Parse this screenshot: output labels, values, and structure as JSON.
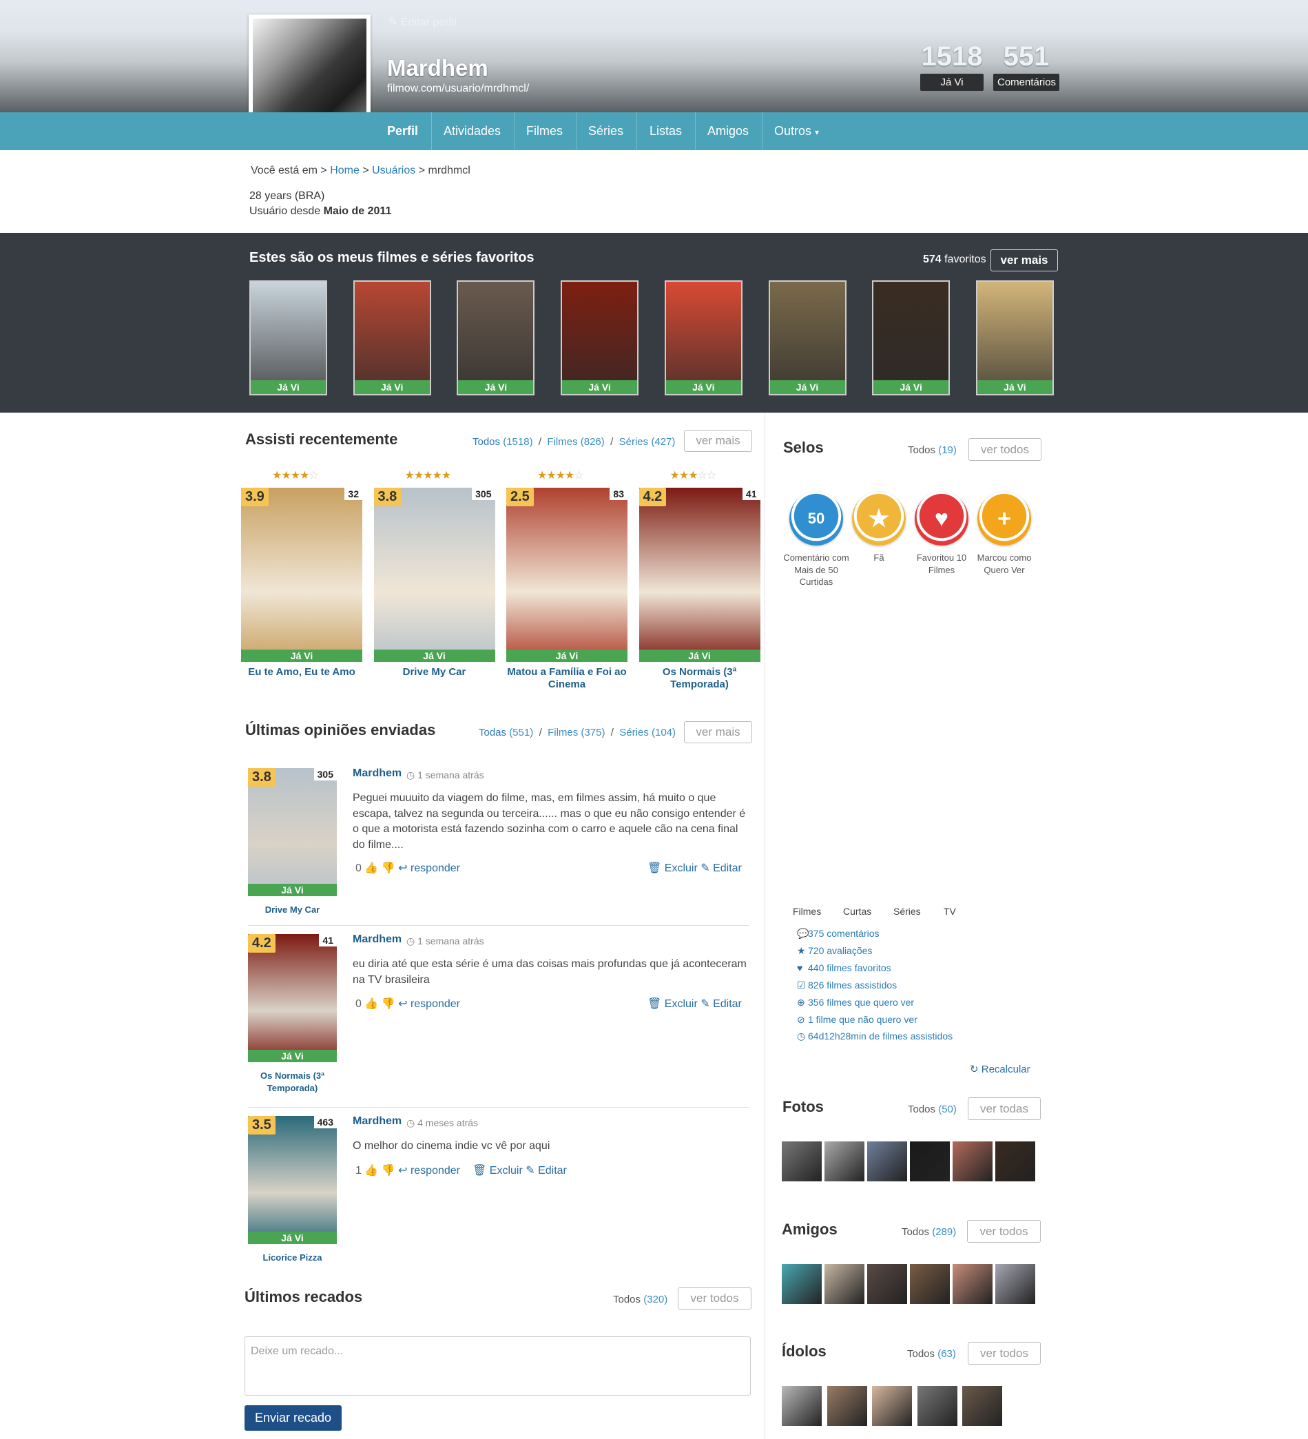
{
  "header": {
    "edit_profile": "Editar perfil",
    "username": "Mardhem",
    "url": "filmow.com/usuario/mrdhmcl/",
    "stats": [
      {
        "value": "1518",
        "label": "Já Vi"
      },
      {
        "value": "551",
        "label": "Comentários"
      }
    ]
  },
  "nav": {
    "items": [
      "Perfil",
      "Atividades",
      "Filmes",
      "Séries",
      "Listas",
      "Amigos",
      "Outros"
    ]
  },
  "breadcrumb": {
    "prefix": "Você está em >",
    "home": "Home",
    "sep": ">",
    "users": "Usuários",
    "current": "> mrdhmcl"
  },
  "profile_info": {
    "age": "28 years (BRA)",
    "since_label": "Usuário desde",
    "since_value": "Maio de 2011"
  },
  "favorites": {
    "title": "Estes são os meus filmes e séries favoritos",
    "count": "574",
    "count_label": "favoritos",
    "more": "ver mais",
    "badge": "Já Vi",
    "colors": [
      "#c9d4dc",
      "#b84733",
      "#6a5a4e",
      "#7e1f12",
      "#d94a33",
      "#7a6a4a",
      "#3a2c22",
      "#d3b57a"
    ]
  },
  "recent": {
    "title": "Assisti recentemente",
    "filters": [
      {
        "label": "Todos",
        "count": "(1518)"
      },
      {
        "label": "Filmes",
        "count": "(826)"
      },
      {
        "label": "Séries",
        "count": "(427)"
      }
    ],
    "more": "ver mais",
    "items": [
      {
        "rating": "3.9",
        "count": "32",
        "title": "Eu te Amo, Eu te Amo",
        "stars": 3.5,
        "badge": "Já Vi"
      },
      {
        "rating": "3.8",
        "count": "305",
        "title": "Drive My Car",
        "stars": 4.5,
        "badge": "Já Vi"
      },
      {
        "rating": "2.5",
        "count": "83",
        "title": "Matou a Família e Foi ao Cinema",
        "stars": 4,
        "badge": "Já Vi"
      },
      {
        "rating": "4.2",
        "count": "41",
        "title": "Os Normais (3ª Temporada)",
        "stars": 3,
        "badge": "Já Vi"
      }
    ]
  },
  "opinions": {
    "title": "Últimas opiniões enviadas",
    "filters": [
      {
        "label": "Todas",
        "count": "(551)"
      },
      {
        "label": "Filmes",
        "count": "(375)"
      },
      {
        "label": "Séries",
        "count": "(104)"
      }
    ],
    "more": "ver mais",
    "items": [
      {
        "rating": "3.8",
        "count": "305",
        "movie": "Drive My Car",
        "author": "Mardhem",
        "time": "1 semana atrás",
        "text": "Peguei muuuito da viagem do filme, mas, em filmes assim, há muito o que escapa, talvez na segunda ou terceira...... mas o que eu não consigo entender é o que a motorista está fazendo sozinha com o carro e aquele cão na cena final do filme....",
        "likes": "0",
        "reply": "responder",
        "delete": "Excluir",
        "edit": "Editar",
        "badge": "Já Vi"
      },
      {
        "rating": "4.2",
        "count": "41",
        "movie": "Os Normais (3ª Temporada)",
        "author": "Mardhem",
        "time": "1 semana atrás",
        "text": "eu diria até que esta série é uma das coisas mais profundas que já aconteceram na TV brasileira",
        "likes": "0",
        "reply": "responder",
        "delete": "Excluir",
        "edit": "Editar",
        "badge": "Já Vi"
      },
      {
        "rating": "3.5",
        "count": "463",
        "movie": "Licorice Pizza",
        "author": "Mardhem",
        "time": "4 meses atrás",
        "text": "O melhor do cinema indie vc vê por aqui",
        "likes": "1",
        "reply": "responder",
        "delete": "Excluir",
        "edit": "Editar",
        "badge": "Já Vi"
      }
    ]
  },
  "messages": {
    "title": "Últimos recados",
    "filter_label": "Todos",
    "filter_count": "(320)",
    "more": "ver todos",
    "placeholder": "Deixe um recado...",
    "send": "Enviar recado"
  },
  "badges": {
    "title": "Selos",
    "filter_label": "Todos",
    "filter_count": "(19)",
    "more": "ver todos",
    "items": [
      {
        "label": "Comentário com Mais de 50 Curtidas",
        "color": "#2f8fd0",
        "glyph": "50"
      },
      {
        "label": "Fã",
        "color": "#f0b63a",
        "glyph": "★"
      },
      {
        "label": "Favoritou 10 Filmes",
        "color": "#e23a3a",
        "glyph": "♥"
      },
      {
        "label": "Marcou como Quero Ver",
        "color": "#f3a51c",
        "glyph": "+"
      }
    ]
  },
  "stats": {
    "tabs": [
      "Filmes",
      "Curtas",
      "Séries",
      "TV"
    ],
    "lines": [
      {
        "icon": "comments-icon",
        "glyph": "💬",
        "text": "375 comentários"
      },
      {
        "icon": "star-icon",
        "glyph": "★",
        "text": "720 avaliações"
      },
      {
        "icon": "heart-icon",
        "glyph": "♥",
        "text": "440 filmes favoritos"
      },
      {
        "icon": "check-icon",
        "glyph": "☑",
        "text": "826 filmes assistidos"
      },
      {
        "icon": "plus-icon",
        "glyph": "⊕",
        "text": "356 filmes que quero ver"
      },
      {
        "icon": "ban-icon",
        "glyph": "⊘",
        "text": "1 filme que não quero ver"
      },
      {
        "icon": "clock-icon",
        "glyph": "◷",
        "text": "64d12h28min de filmes assistidos"
      }
    ],
    "recalc": "Recalcular"
  },
  "photos": {
    "title": "Fotos",
    "filter_label": "Todos",
    "filter_count": "(50)",
    "more": "ver todas",
    "colors": [
      "#777",
      "#aaa",
      "#6f7f9a",
      "#1a1a1a",
      "#b26b5c",
      "#3a2a20"
    ]
  },
  "friends": {
    "title": "Amigos",
    "filter_label": "Todos",
    "filter_count": "(289)",
    "more": "ver todos",
    "colors": [
      "#4aa7b2",
      "#c7b7a4",
      "#5a4a44",
      "#7a5c44",
      "#c68d7a",
      "#a7a7b5"
    ]
  },
  "idols": {
    "title": "Ídolos",
    "filter_label": "Todos",
    "filter_count": "(63)",
    "more": "ver todos",
    "colors": [
      "#b9b9b9",
      "#9a7c66",
      "#d8b8a0",
      "#777",
      "#6a5a4a"
    ]
  }
}
